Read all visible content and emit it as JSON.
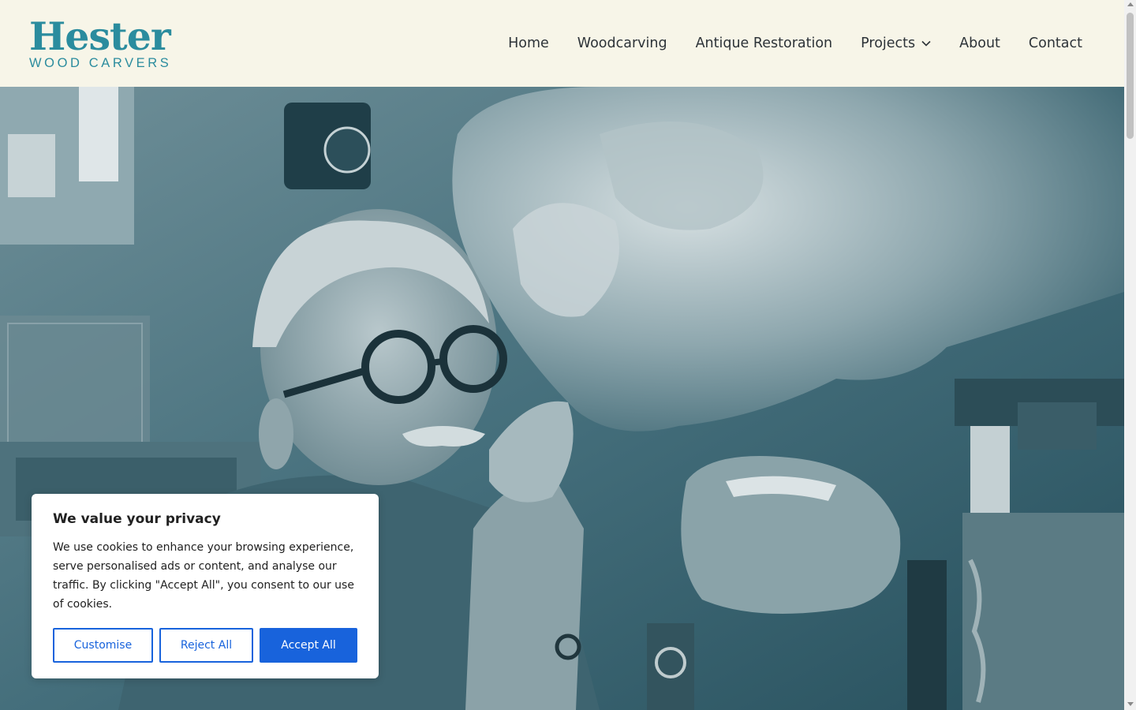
{
  "brand": {
    "name": "Hester",
    "tagline": "WOOD CARVERS",
    "color": "#2b8c9e"
  },
  "nav": {
    "items": [
      {
        "label": "Home"
      },
      {
        "label": "Woodcarving"
      },
      {
        "label": "Antique Restoration"
      },
      {
        "label": "Projects",
        "has_dropdown": true,
        "icon": "chevron-down-icon"
      },
      {
        "label": "About"
      },
      {
        "label": "Contact"
      }
    ]
  },
  "hero": {
    "image": "woodcarver-with-carving-photo",
    "tint": "#3d6b7a"
  },
  "cookie_banner": {
    "title": "We value your privacy",
    "text": "We use cookies to enhance your browsing experience, serve personalised ads or content, and analyse our traffic. By clicking \"Accept All\", you consent to our use of cookies.",
    "buttons": {
      "customise": "Customise",
      "reject": "Reject All",
      "accept": "Accept All"
    },
    "accent": "#1863dc"
  }
}
